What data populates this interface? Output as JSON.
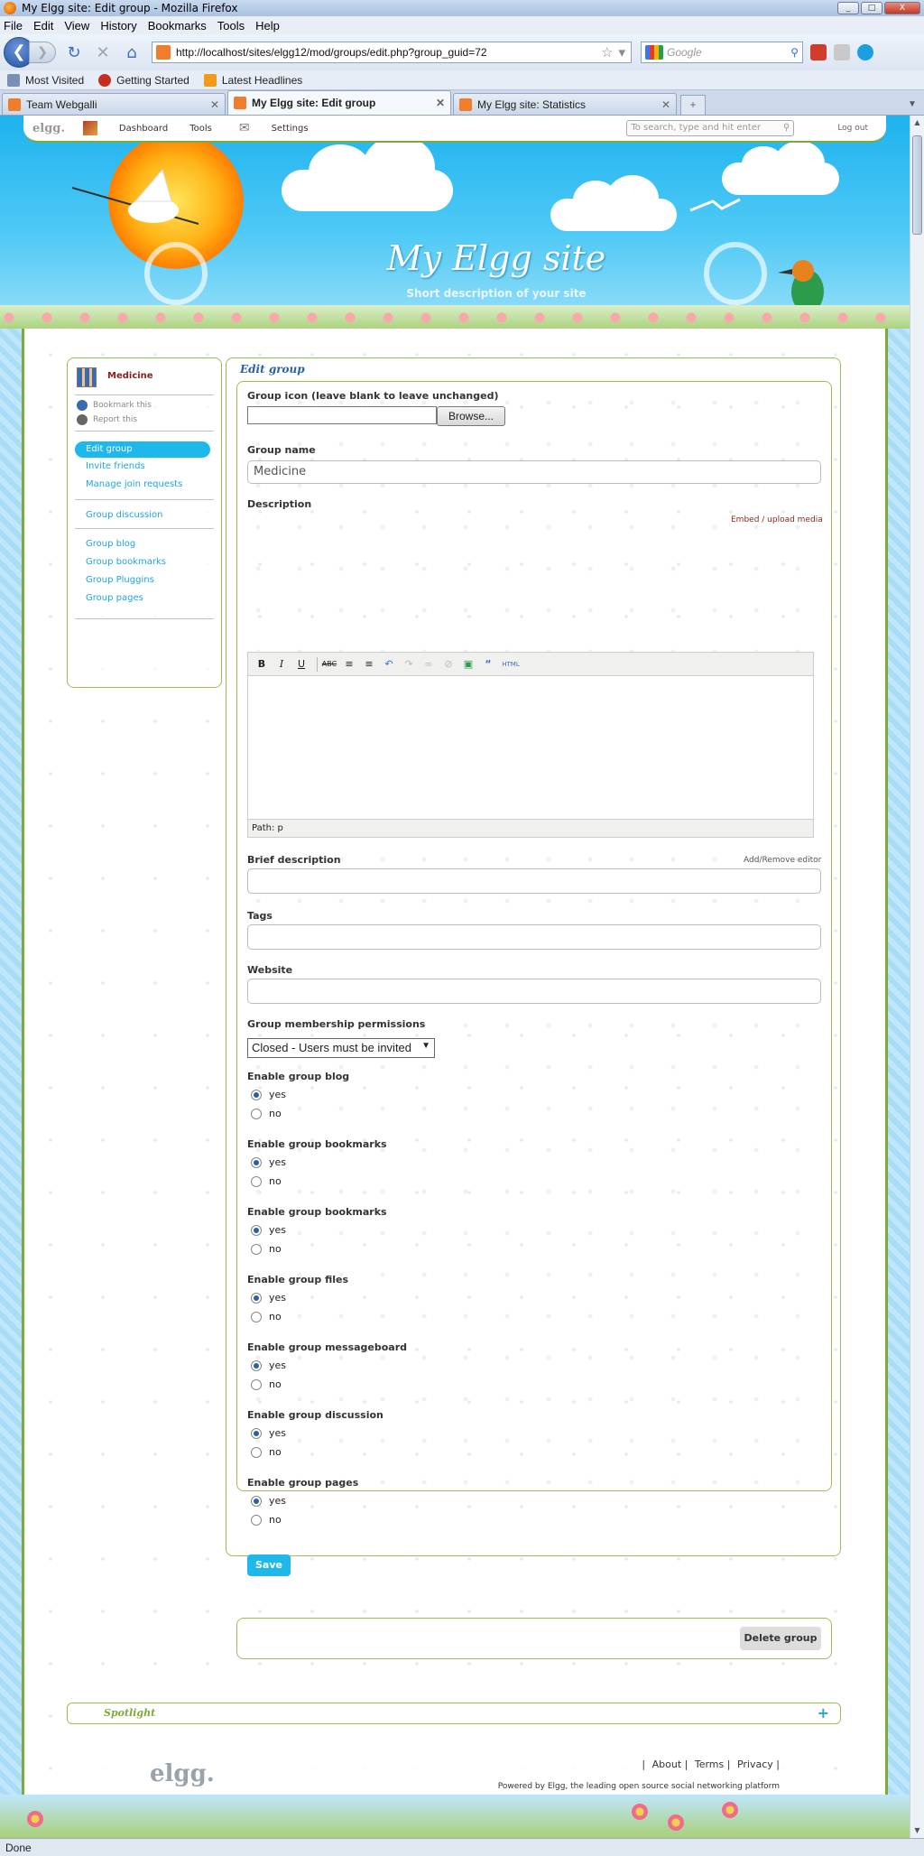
{
  "window": {
    "title": "My Elgg site: Edit group - Mozilla Firefox",
    "buttons": {
      "minimize": "_",
      "maximize": "□",
      "close": "X"
    }
  },
  "menu": [
    "File",
    "Edit",
    "View",
    "History",
    "Bookmarks",
    "Tools",
    "Help"
  ],
  "nav": {
    "url": "http://localhost/sites/elgg12/mod/groups/edit.php?group_guid=72",
    "search_placeholder": "Google"
  },
  "bookmarks": [
    "Most Visited",
    "Getting Started",
    "Latest Headlines"
  ],
  "tabs": [
    {
      "label": "Team Webgalli"
    },
    {
      "label": "My Elgg site: Edit group"
    },
    {
      "label": "My Elgg site: Statistics"
    }
  ],
  "topbar": {
    "logo": "elgg.",
    "links": [
      "Dashboard",
      "Tools",
      "Settings"
    ],
    "search_placeholder": "To search, type and hit enter",
    "logout": "Log out"
  },
  "site": {
    "title": "My Elgg site",
    "description": "Short description of your site"
  },
  "sidebar": {
    "group_name": "Medicine",
    "tools": [
      "Bookmark this",
      "Report this"
    ],
    "links": [
      "Edit group",
      "Invite friends",
      "Manage join requests",
      "Group discussion",
      "Group blog",
      "Group bookmarks",
      "Group Pluggins",
      "Group pages"
    ]
  },
  "form": {
    "title": "Edit group",
    "icon_label": "Group icon (leave blank to leave unchanged)",
    "browse_label": "Browse...",
    "name_label": "Group name",
    "name_value": "Medicine",
    "description_label": "Description",
    "embed_link": "Embed / upload media",
    "editor_path": "Path: p",
    "brief_label": "Brief description",
    "toggle_editor": "Add/Remove editor",
    "tags_label": "Tags",
    "website_label": "Website",
    "membership_label": "Group membership permissions",
    "membership_value": "Closed - Users must be invited",
    "enable_sections": [
      {
        "label": "Enable group blog",
        "yes": "yes",
        "no": "no",
        "selected": "yes"
      },
      {
        "label": "Enable group bookmarks",
        "yes": "yes",
        "no": "no",
        "selected": "yes"
      },
      {
        "label": "Enable group bookmarks",
        "yes": "yes",
        "no": "no",
        "selected": "yes"
      },
      {
        "label": "Enable group files",
        "yes": "yes",
        "no": "no",
        "selected": "yes"
      },
      {
        "label": "Enable group messageboard",
        "yes": "yes",
        "no": "no",
        "selected": "yes"
      },
      {
        "label": "Enable group discussion",
        "yes": "yes",
        "no": "no",
        "selected": "yes"
      },
      {
        "label": "Enable group pages",
        "yes": "yes",
        "no": "no",
        "selected": "yes"
      }
    ],
    "save_label": "Save",
    "delete_label": "Delete group"
  },
  "spotlight": {
    "title": "Spotlight",
    "toggle": "+"
  },
  "footer": {
    "logo": "elgg.",
    "links": [
      "About",
      "Terms",
      "Privacy"
    ],
    "powered": "Powered by Elgg, the leading open source social networking platform"
  },
  "status": "Done",
  "colors": {
    "accent": "#1fb8ea",
    "border": "#9bbf5a",
    "sky": "#1eb2ee"
  }
}
